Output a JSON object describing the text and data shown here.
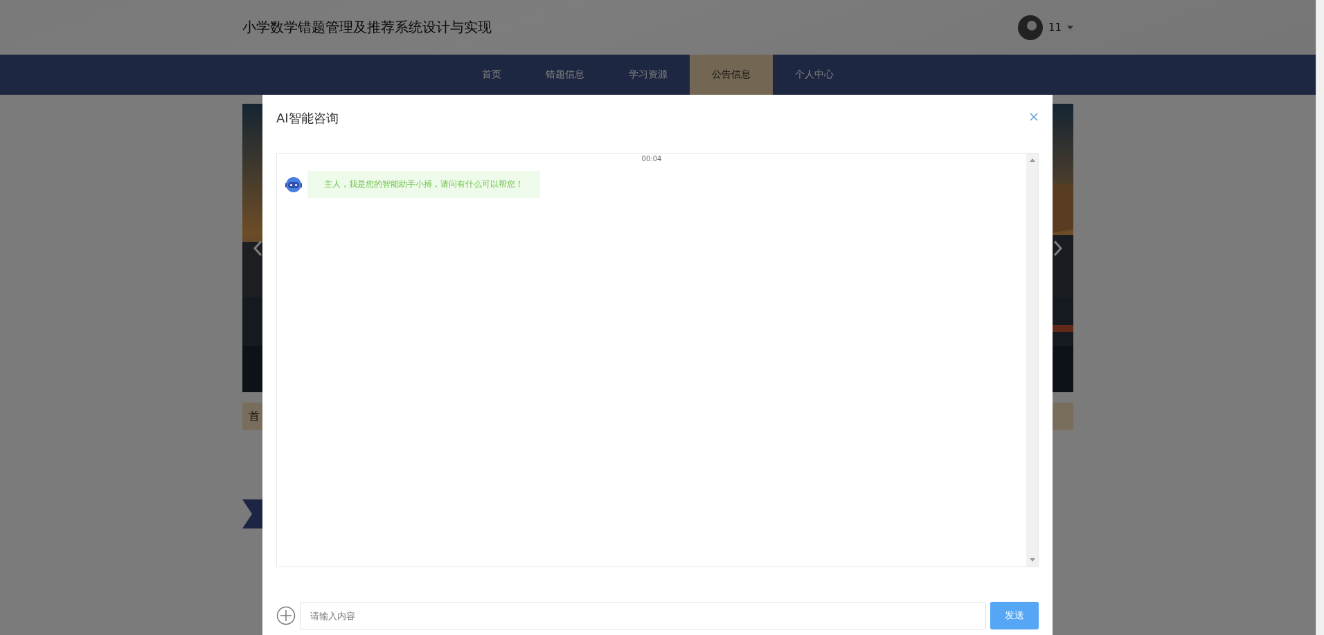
{
  "header": {
    "title": "小学数学错题管理及推荐系统设计与实现",
    "user_name": "11"
  },
  "nav": [
    {
      "label": "首页",
      "selected": false
    },
    {
      "label": "错题信息",
      "selected": false
    },
    {
      "label": "学习资源",
      "selected": false
    },
    {
      "label": "公告信息",
      "selected": true
    },
    {
      "label": "个人中心",
      "selected": false
    }
  ],
  "caption": "首",
  "dialog": {
    "title": "AI智能咨询",
    "messages": [
      {
        "kind": "time",
        "text": "00:04"
      },
      {
        "kind": "bot",
        "text": "主人，我是您的智能助手小搏，请问有什么可以帮您！"
      }
    ],
    "input": {
      "placeholder": "请输入内容"
    },
    "send_button": "发送"
  }
}
